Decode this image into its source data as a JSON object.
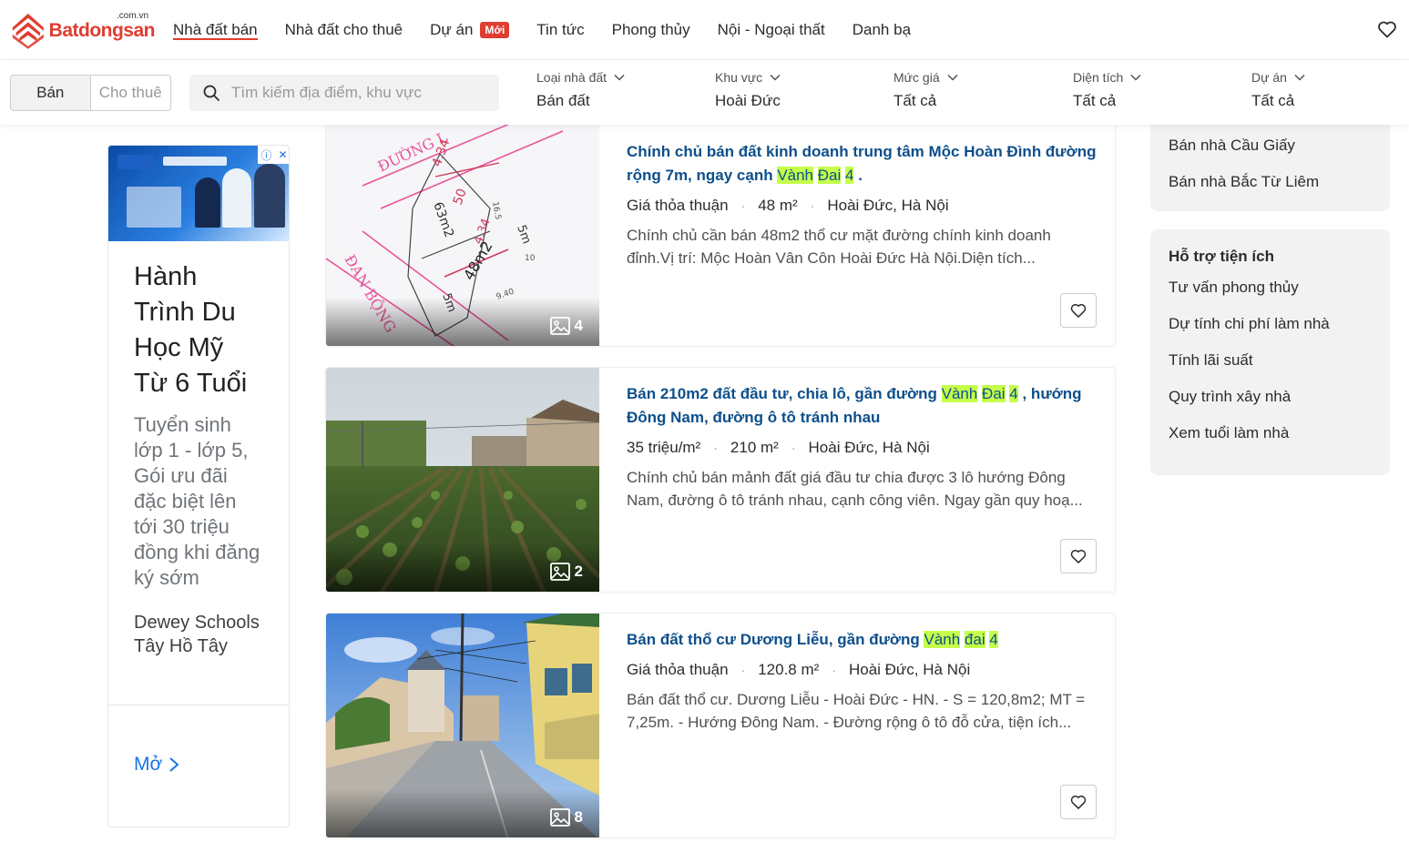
{
  "header": {
    "logo_text": "Batdongsan",
    "logo_domain": ".com.vn",
    "nav": [
      {
        "label": "Nhà đất bán",
        "active": true
      },
      {
        "label": "Nhà đất cho thuê"
      },
      {
        "label": "Dự án",
        "badge": "Mới"
      },
      {
        "label": "Tin tức"
      },
      {
        "label": "Phong thủy"
      },
      {
        "label": "Nội - Ngoại thất"
      },
      {
        "label": "Danh bạ"
      }
    ]
  },
  "filters": {
    "mode": {
      "sell": "Bán",
      "rent": "Cho thuê"
    },
    "search_placeholder": "Tìm kiếm địa điểm, khu vực",
    "items": [
      {
        "label": "Loại nhà đất",
        "value": "Bán đất"
      },
      {
        "label": "Khu vực",
        "value": "Hoài Đức"
      },
      {
        "label": "Mức giá",
        "value": "Tất cả"
      },
      {
        "label": "Diện tích",
        "value": "Tất cả"
      },
      {
        "label": "Dự án",
        "value": "Tất cả"
      }
    ]
  },
  "ad": {
    "title": "Hành Trình Du Học Mỹ Từ 6 Tuổi",
    "text": "Tuyển sinh lớp 1 - lớp 5, Gói ưu đãi đặc biệt lên tới 30 triệu đồng khi đăng ký sớm",
    "brand": "Dewey Schools Tây Hồ Tây",
    "open_label": "Mở"
  },
  "listings": [
    {
      "title_before": "Chính chủ bán đất kinh doanh trung tâm Mộc Hoàn Đình đường rộng 7m, ngay cạnh ",
      "hl1": "Vành",
      "hl2": "Đai",
      "hl3": "4",
      "title_after": " .",
      "price": "Giá thỏa thuận",
      "area": "48 m²",
      "location": "Hoài Đức, Hà Nội",
      "description": "Chính chủ cần bán 48m2 thổ cư mặt đường chính kinh doanh đỉnh.Vị trí: Mộc Hoàn Vân Côn Hoài Đức Hà Nội.Diện tích...",
      "image_count": "4"
    },
    {
      "title_before": "Bán 210m2 đất đầu tư, chia lô, gần đường ",
      "hl1": "Vành",
      "hl2": "Đai",
      "hl3": "4",
      "title_after": " , hướng Đông Nam, đường ô tô tránh nhau",
      "price": "35 triệu/m²",
      "area": "210 m²",
      "location": "Hoài Đức, Hà Nội",
      "description": "Chính chủ bán mảnh đất giá đầu tư chia được 3 lô hướng Đông Nam, đường ô tô tránh nhau, cạnh công viên. Ngay gần quy hoạ...",
      "image_count": "2"
    },
    {
      "title_before": "Bán đất thổ cư Dương Liễu, gần đường ",
      "hl1": "Vành",
      "hl2": "đai",
      "hl3": "4",
      "title_after": "",
      "price": "Giá thỏa thuận",
      "area": "120.8 m²",
      "location": "Hoài Đức, Hà Nội",
      "description": "Bán đất thổ cư. Dương Liễu - Hoài Đức - HN. - S = 120,8m2; MT = 7,25m. - Hướng Đông Nam. - Đường rộng ô tô đỗ cửa, tiện ích...",
      "image_count": "8"
    }
  ],
  "plan": {
    "street_top": "ĐƯỜNG L",
    "street_left": "ĐAN BỘNG",
    "d1": "4.34",
    "d2": "50",
    "d3": "63m2",
    "d4": "4.34",
    "d5": "48m2",
    "d6": "5m",
    "d7": "5m",
    "d8": "16.5",
    "d9": "10",
    "d10": "9.40"
  },
  "sidebar": {
    "top_links": [
      "Bán nhà Cầu Giấy",
      "Bán nhà Bắc Từ Liêm"
    ],
    "tools_title": "Hỗ trợ tiện ích",
    "tools": [
      "Tư vấn phong thủy",
      "Dự tính chi phí làm nhà",
      "Tính lãi suất",
      "Quy trình xây nhà",
      "Xem tuổi làm nhà"
    ]
  },
  "colors": {
    "brand": "#e03c31",
    "title": "#0d4f8b",
    "highlight": "#c5ff4a"
  }
}
